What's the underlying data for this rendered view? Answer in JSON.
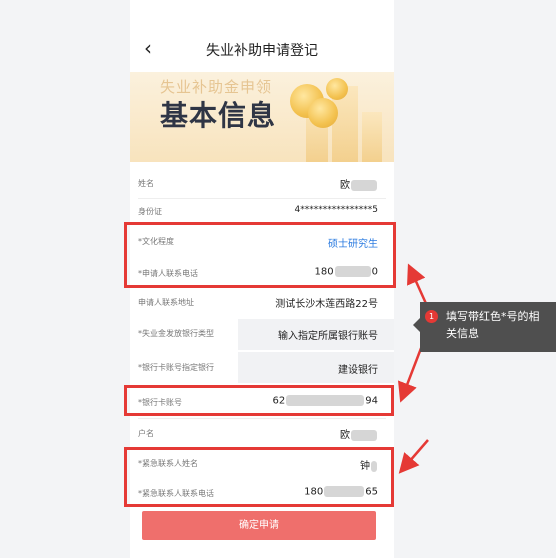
{
  "header": {
    "back_icon": "chevron-left-icon",
    "title": "失业补助申请登记"
  },
  "banner": {
    "subtitle": "失业补助金申领",
    "heading": "基本信息"
  },
  "fields": [
    {
      "label": "姓名",
      "value": "欧",
      "required": false
    },
    {
      "label": "身份证",
      "value": "4****************5",
      "required": false
    },
    {
      "label": "*文化程度",
      "value": "硕士研究生",
      "required": true
    },
    {
      "label": "*申请人联系电话",
      "value_prefix": "180",
      "value_suffix": "0",
      "required": true
    },
    {
      "label": "申请人联系地址",
      "value": "测试长沙木莲西路22号",
      "required": false
    },
    {
      "label": "*失业金发放银行类型",
      "value": "输入指定所属银行账号",
      "required": true
    },
    {
      "label": "*银行卡账号指定银行",
      "value": "建设银行",
      "required": true
    },
    {
      "label": "*银行卡账号",
      "value_prefix": "62",
      "value_suffix": "94",
      "required": true
    },
    {
      "label": "户名",
      "value": "欧",
      "required": false
    },
    {
      "label": "*紧急联系人姓名",
      "value": "钟",
      "required": true
    },
    {
      "label": "*紧急联系人联系电话",
      "value_prefix": "180",
      "value_suffix": "65",
      "required": true
    }
  ],
  "submit_label": "确定申请",
  "tooltip": {
    "number": "1",
    "text": "填写带红色*号的相关信息"
  },
  "colors": {
    "accent_red": "#e53935",
    "link_blue": "#2b7be0",
    "button": "#ef6f6c"
  }
}
